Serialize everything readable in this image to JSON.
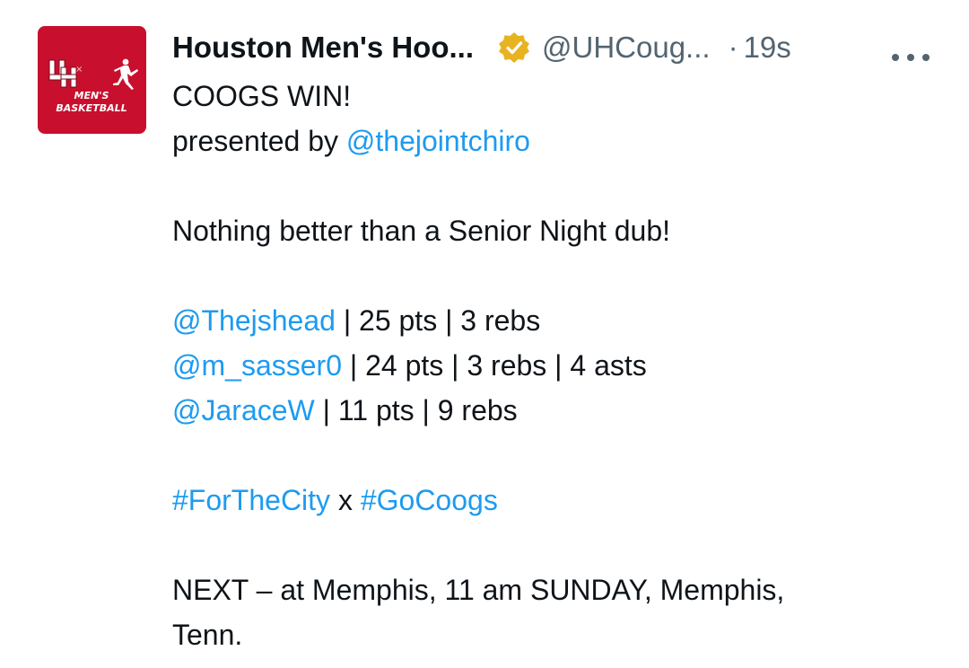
{
  "tweet": {
    "author_name": "Houston Men's Hoo...",
    "handle": "@UHCoug...",
    "separator": "·",
    "time": "19s",
    "avatar": {
      "logo_text": "UH",
      "brand_mark": "jordan-jumpman",
      "line1": "MEN'S",
      "line2": "BASKETBALL",
      "bg_color": "#c8102e"
    },
    "verified_badge_color": "#e8b321",
    "more_icon": "more-horizontal-icon",
    "link_color": "#1d9bf0",
    "body": {
      "headline": "COOGS WIN!",
      "presented_prefix": "presented by ",
      "presented_link": "@thejointchiro",
      "line_dub": "Nothing better than a Senior Night dub!",
      "stats": [
        {
          "mention": "@Thejshead",
          "text": " | 25 pts | 3 rebs"
        },
        {
          "mention": "@m_sasser0",
          "text": " | 24 pts | 3 rebs | 4 asts"
        },
        {
          "mention": "@JaraceW",
          "text": " | 11 pts | 9 rebs"
        }
      ],
      "hashtag1": "#ForTheCity",
      "hashtag_sep": " x ",
      "hashtag2": "#GoCoogs",
      "next_line1": "NEXT – at Memphis, 11 am SUNDAY, Memphis,",
      "next_line2": "Tenn."
    }
  }
}
